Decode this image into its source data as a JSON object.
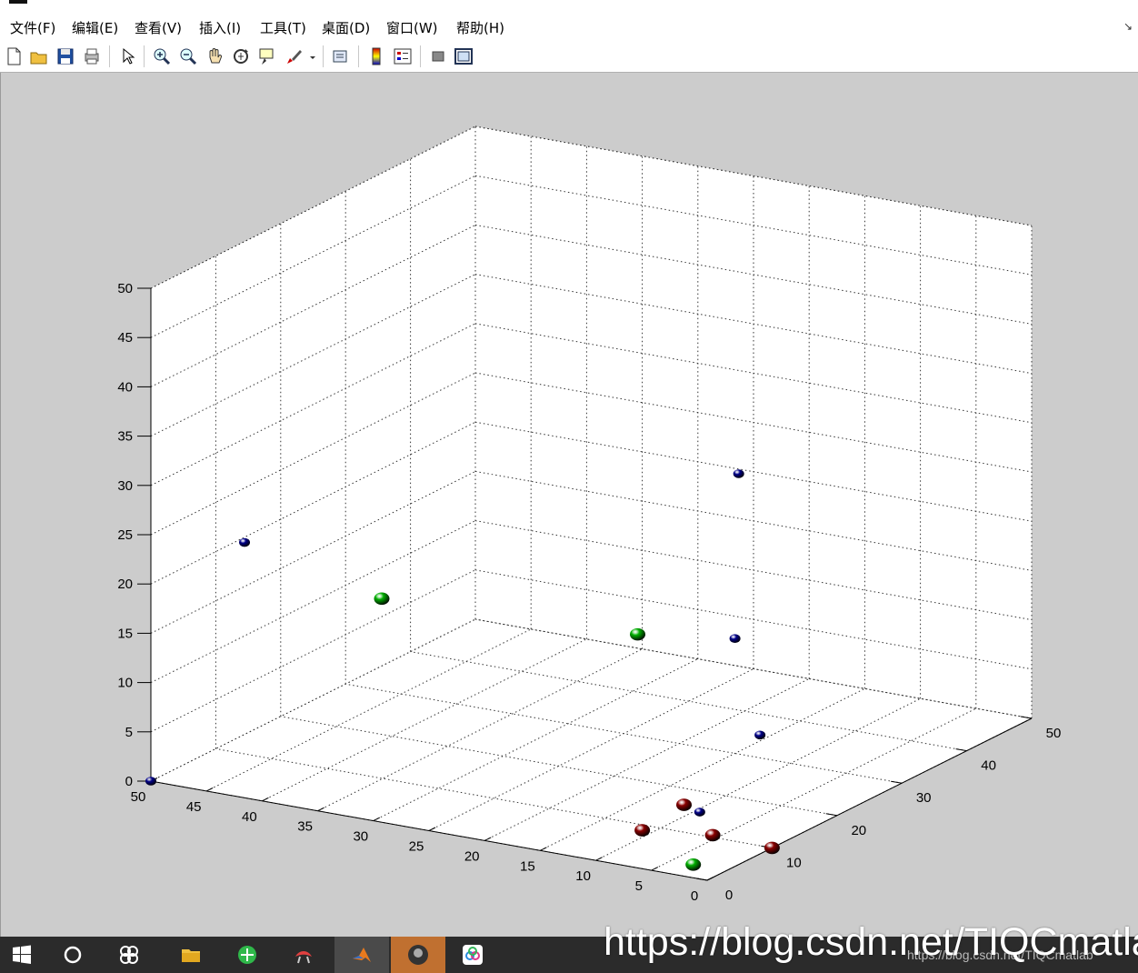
{
  "menu": [
    "文件(F)",
    "编辑(E)",
    "查看(V)",
    "插入(I)",
    "工具(T)",
    "桌面(D)",
    "窗口(W)",
    "帮助(H)"
  ],
  "toolbar": {
    "items": [
      "new-figure-icon",
      "open-file-icon",
      "save-icon",
      "print-icon",
      "edit-plot-arrow-icon",
      "zoom-in-icon",
      "zoom-out-icon",
      "pan-hand-icon",
      "rotate-3d-icon",
      "data-cursor-icon",
      "brush-icon",
      "link-plot-icon",
      "colorbar-icon",
      "legend-icon",
      "hide-plot-tools-icon",
      "show-plot-tools-icon"
    ]
  },
  "chart_data": {
    "type": "scatter3d",
    "xlim": [
      0,
      50
    ],
    "ylim": [
      0,
      50
    ],
    "zlim": [
      0,
      50
    ],
    "x_ticks": [
      0,
      5,
      10,
      15,
      20,
      25,
      30,
      35,
      40,
      45,
      50
    ],
    "y_ticks": [
      0,
      10,
      20,
      30,
      40,
      50
    ],
    "z_ticks": [
      0,
      5,
      10,
      15,
      20,
      25,
      30,
      35,
      40,
      45,
      50
    ],
    "grid": true,
    "colors": {
      "blue": "#00008b",
      "green": "#00b000",
      "red": "#8b0000"
    },
    "points": [
      {
        "x": 50,
        "y": 0,
        "z": 0,
        "color": "blue"
      },
      {
        "x": 48,
        "y": 11,
        "z": 21,
        "color": "blue"
      },
      {
        "x": 38,
        "y": 15,
        "z": 16,
        "color": "green"
      },
      {
        "x": 15,
        "y": 15,
        "z": 17,
        "color": "green"
      },
      {
        "x": 10,
        "y": 22,
        "z": 32,
        "color": "blue"
      },
      {
        "x": 8,
        "y": 18,
        "z": 17,
        "color": "blue"
      },
      {
        "x": 4,
        "y": 15,
        "z": 9,
        "color": "blue"
      },
      {
        "x": 3,
        "y": 4,
        "z": 5,
        "color": "blue"
      },
      {
        "x": 5,
        "y": 5,
        "z": 5,
        "color": "red"
      },
      {
        "x": 7,
        "y": 2,
        "z": 3,
        "color": "red"
      },
      {
        "x": 3,
        "y": 6,
        "z": 2,
        "color": "red"
      },
      {
        "x": 3,
        "y": 3,
        "z": 0,
        "color": "green"
      },
      {
        "x": 0,
        "y": 10,
        "z": 0,
        "color": "red"
      }
    ]
  },
  "taskbar": {
    "items": [
      "windows-start-icon",
      "cortana-search-icon",
      "app-pinwheel-icon",
      "file-explorer-icon",
      "browser-green-icon",
      "app-red-icon",
      "matlab-icon",
      "app-avatar-icon",
      "app-cloud-icon"
    ]
  },
  "watermark": "https://blog.csdn.net/TIQCmatlab",
  "watermark_small": "https://blog.csdn.net/TIQCmatlab"
}
